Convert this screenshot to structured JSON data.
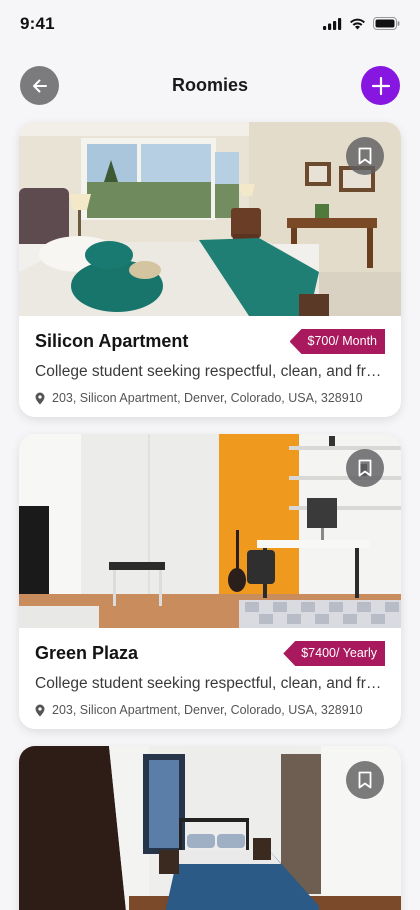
{
  "status_bar": {
    "time": "9:41",
    "icons": [
      "signal-icon",
      "wifi-icon",
      "battery-icon"
    ]
  },
  "header": {
    "title": "Roomies",
    "back_icon": "arrow-left-icon",
    "add_icon": "plus-icon"
  },
  "colors": {
    "accent": "#8716e0",
    "price_tag": "#a8195e",
    "back_button": "#7b7b7d",
    "background": "#f6f6f8"
  },
  "listings": [
    {
      "title": "Silicon Apartment",
      "price": "$700/ Month",
      "description": "College student seeking respectful, clean, and friendly roommate",
      "address": "203, Silicon Apartment, Denver, Colorado, USA, 328910",
      "bookmark_icon": "bookmark-icon"
    },
    {
      "title": "Green Plaza",
      "price": "$7400/ Yearly",
      "description": "College student seeking respectful, clean, and friendly roommate",
      "address": "203, Silicon Apartment, Denver, Colorado, USA, 328910",
      "bookmark_icon": "bookmark-icon"
    },
    {
      "title": "",
      "price": "",
      "description": "",
      "address": "",
      "bookmark_icon": "bookmark-icon"
    }
  ]
}
